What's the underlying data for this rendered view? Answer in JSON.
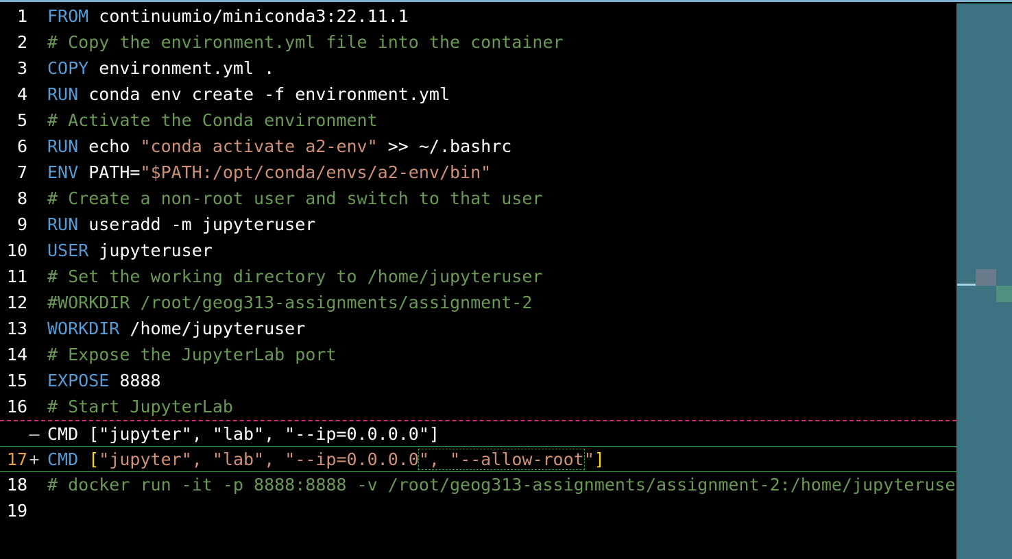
{
  "editor": {
    "lines": [
      {
        "n": "1",
        "tokens": [
          {
            "t": "FROM",
            "c": "kw"
          },
          {
            "t": " continuumio/miniconda3:22.11.1",
            "c": ""
          }
        ]
      },
      {
        "n": "2",
        "tokens": [
          {
            "t": "# Copy the environment.yml file into the container",
            "c": "cm"
          }
        ]
      },
      {
        "n": "3",
        "tokens": [
          {
            "t": "COPY",
            "c": "kw"
          },
          {
            "t": " environment.yml .",
            "c": ""
          }
        ]
      },
      {
        "n": "4",
        "tokens": [
          {
            "t": "RUN",
            "c": "kw"
          },
          {
            "t": " conda env create -f environment.yml",
            "c": ""
          }
        ]
      },
      {
        "n": "5",
        "tokens": [
          {
            "t": "# Activate the Conda environment",
            "c": "cm"
          }
        ]
      },
      {
        "n": "6",
        "tokens": [
          {
            "t": "RUN",
            "c": "kw"
          },
          {
            "t": " echo ",
            "c": ""
          },
          {
            "t": "\"conda activate a2-env\"",
            "c": "st"
          },
          {
            "t": " >> ~/.bashrc",
            "c": ""
          }
        ]
      },
      {
        "n": "7",
        "tokens": [
          {
            "t": "ENV",
            "c": "kw"
          },
          {
            "t": " PATH=",
            "c": ""
          },
          {
            "t": "\"$PATH:/opt/conda/envs/a2-env/bin\"",
            "c": "st"
          }
        ]
      },
      {
        "n": "8",
        "tokens": [
          {
            "t": "# Create a non-root user and switch to that user",
            "c": "cm"
          }
        ]
      },
      {
        "n": "9",
        "tokens": [
          {
            "t": "RUN",
            "c": "kw"
          },
          {
            "t": " useradd -m jupyteruser",
            "c": ""
          }
        ]
      },
      {
        "n": "10",
        "tokens": [
          {
            "t": "USER",
            "c": "kw"
          },
          {
            "t": " jupyteruser",
            "c": ""
          }
        ]
      },
      {
        "n": "11",
        "tokens": [
          {
            "t": "# Set the working directory to /home/jupyteruser",
            "c": "cm"
          }
        ]
      },
      {
        "n": "12",
        "tokens": [
          {
            "t": "#WORKDIR /root/geog313-assignments/assignment-2",
            "c": "cm"
          }
        ]
      },
      {
        "n": "13",
        "tokens": [
          {
            "t": "WORKDIR",
            "c": "kw"
          },
          {
            "t": " /home/jupyteruser",
            "c": ""
          }
        ]
      },
      {
        "n": "14",
        "tokens": [
          {
            "t": "# Expose the JupyterLab port",
            "c": "cm"
          }
        ]
      },
      {
        "n": "15",
        "tokens": [
          {
            "t": "EXPOSE",
            "c": "kw"
          },
          {
            "t": " 8888",
            "c": ""
          }
        ]
      },
      {
        "n": "16",
        "tokens": [
          {
            "t": "# Start JupyterLab",
            "c": "cm"
          }
        ]
      },
      {
        "n": "",
        "marker": "—",
        "diff": "removed",
        "tokens": [
          {
            "t": "CMD [\"jupyter\", \"lab\", \"--ip=0.0.0.0\"]",
            "c": ""
          }
        ]
      },
      {
        "n": "17",
        "marker": "+",
        "diff": "added",
        "tokens": [
          {
            "t": "CMD",
            "c": "kw"
          },
          {
            "t": " ",
            "c": ""
          },
          {
            "t": "[",
            "c": "br"
          },
          {
            "t": "\"jupyter\", \"lab\", \"--ip=0.0.0.0",
            "c": "st"
          },
          {
            "t": "\", \"--allow-root",
            "c": "st"
          },
          {
            "t": "\"",
            "c": "st"
          },
          {
            "t": "]",
            "c": "br"
          }
        ]
      },
      {
        "n": "18",
        "tokens": [
          {
            "t": "# docker run -it -p 8888:8888 -v /root/geog313-assignments/assignment-2:/home/jupyteruse",
            "c": "cm"
          }
        ]
      },
      {
        "n": "19",
        "tokens": []
      }
    ]
  }
}
